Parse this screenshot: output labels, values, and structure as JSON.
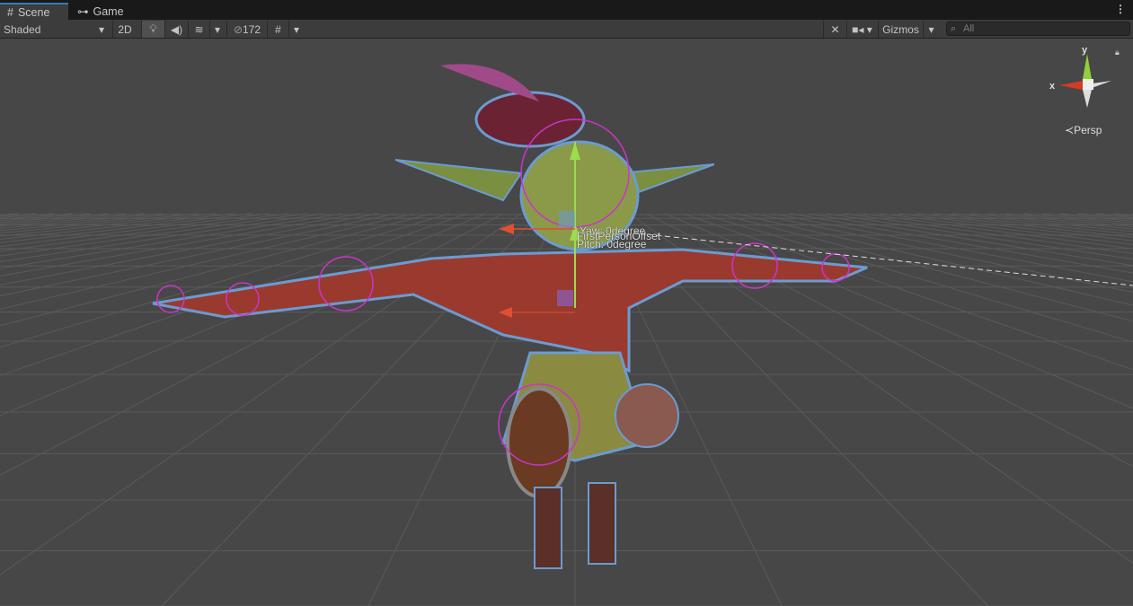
{
  "tabs": [
    {
      "label": "Scene",
      "icon": "grid-icon"
    },
    {
      "label": "Game",
      "icon": "gamepad-icon"
    }
  ],
  "toolbar": {
    "draw_mode": "Shaded",
    "mode_2d": "2D",
    "hidden_count": "172",
    "gizmos": "Gizmos",
    "search_placeholder": "All"
  },
  "scene": {
    "yaw": "Yaw: 0degree",
    "offset": "FirstPersonOffset",
    "pitch": "Pitch: 0degree"
  },
  "orientation": {
    "y": "y",
    "x": "x",
    "projection": "Persp"
  },
  "colors": {
    "accent": "#3a79bb",
    "selection": "#cc33cc",
    "outline": "#6b9bd1"
  }
}
